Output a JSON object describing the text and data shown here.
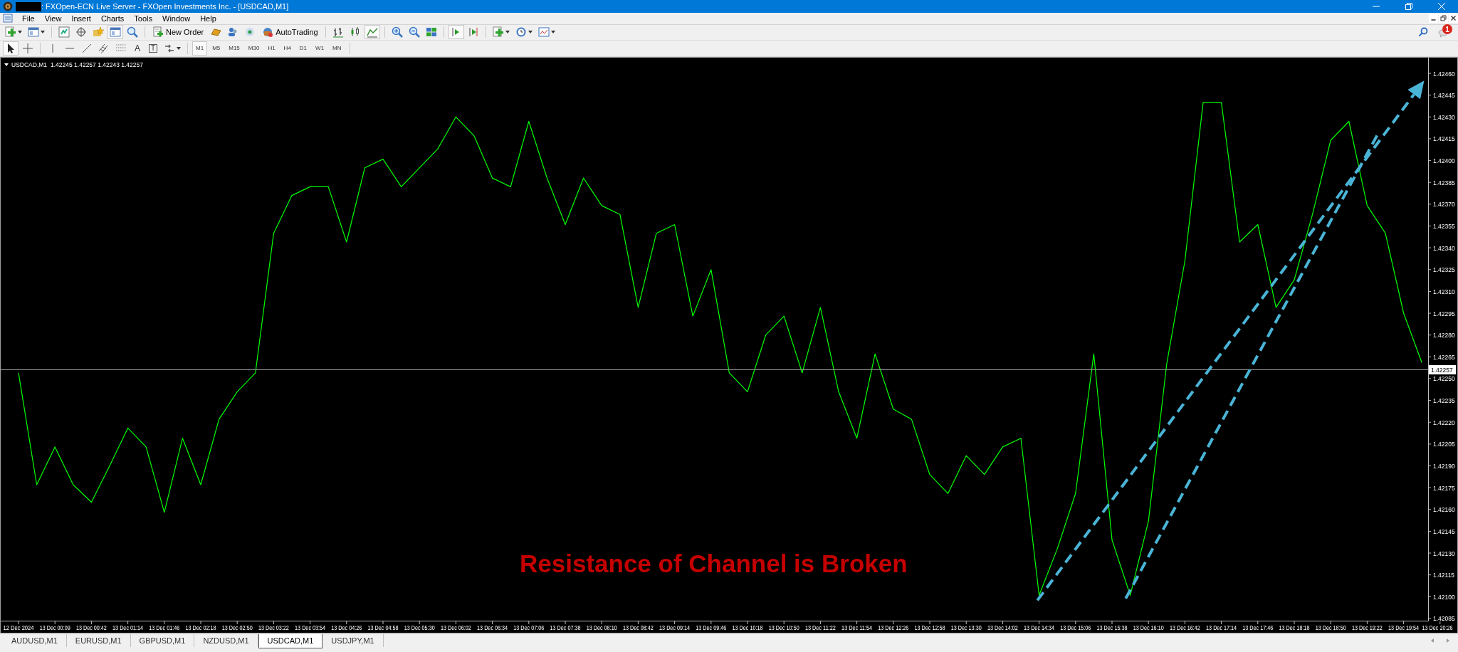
{
  "window": {
    "title": ": FXOpen-ECN Live Server - FXOpen Investments Inc. - [USDCAD,M1]"
  },
  "menu": [
    "File",
    "View",
    "Insert",
    "Charts",
    "Tools",
    "Window",
    "Help"
  ],
  "toolbar": {
    "new_order": "New Order",
    "auto_trading": "AutoTrading",
    "notification_count": "1"
  },
  "drawing_toolbar": {
    "text_tool": "A",
    "label_tool": "T"
  },
  "timeframes": [
    {
      "label": "M1",
      "selected": true
    },
    {
      "label": "M5",
      "selected": false
    },
    {
      "label": "M15",
      "selected": false
    },
    {
      "label": "M30",
      "selected": false
    },
    {
      "label": "H1",
      "selected": false
    },
    {
      "label": "H4",
      "selected": false
    },
    {
      "label": "D1",
      "selected": false
    },
    {
      "label": "W1",
      "selected": false
    },
    {
      "label": "MN",
      "selected": false
    }
  ],
  "chart": {
    "header": "1.42245 1.42257 1.42243 1.42257",
    "annotation": "Resistance of Channel is Broken",
    "chart_data": {
      "type": "line",
      "categories": [
        "12 Dec 2024",
        null,
        "13 Dec 00:09",
        null,
        "13 Dec 00:42",
        null,
        "13 Dec 01:14",
        null,
        "13 Dec 01:46",
        null,
        "13 Dec 02:18",
        null,
        "13 Dec 02:50",
        null,
        "13 Dec 03:22",
        null,
        "13 Dec 03:54",
        null,
        "13 Dec 04:26",
        null,
        "13 Dec 04:58",
        null,
        "13 Dec 05:30",
        null,
        "13 Dec 06:02",
        null,
        "13 Dec 06:34",
        null,
        "13 Dec 07:06",
        null,
        "13 Dec 07:38",
        null,
        "13 Dec 08:10",
        null,
        "13 Dec 08:42",
        null,
        "13 Dec 09:14",
        null,
        "13 Dec 09:46",
        null,
        "13 Dec 10:18",
        null,
        "13 Dec 10:50",
        null,
        "13 Dec 11:22",
        null,
        "13 Dec 11:54",
        null,
        "13 Dec 12:26",
        null,
        "13 Dec 12:58",
        null,
        "13 Dec 13:30",
        null,
        "13 Dec 14:02",
        null,
        "13 Dec 14:34",
        null,
        "13 Dec 15:06",
        null,
        "13 Dec 15:38",
        null,
        "13 Dec 16:10",
        null,
        "13 Dec 16:42",
        null,
        "13 Dec 17:14",
        null,
        "13 Dec 17:46",
        null,
        "13 Dec 18:18",
        null,
        "13 Dec 18:50",
        null,
        "13 Dec 19:22",
        null,
        "13 Dec 19:54",
        null,
        "13 Dec 20:26"
      ],
      "series": [
        {
          "name": "USDCAD,M1",
          "color": "#00ff00",
          "values": [
            1.42254,
            1.42177,
            1.42203,
            1.42177,
            1.42165,
            1.4219,
            1.42216,
            1.42203,
            1.42158,
            1.42209,
            1.42177,
            1.42222,
            1.42241,
            1.42254,
            1.4235,
            1.42376,
            1.42382,
            1.42382,
            1.42344,
            1.42395,
            1.42401,
            1.42382,
            1.42395,
            1.42408,
            1.4243,
            1.42417,
            1.42388,
            1.42382,
            1.42427,
            1.42388,
            1.42356,
            1.42388,
            1.42369,
            1.42363,
            1.42299,
            1.4235,
            1.42356,
            1.42293,
            1.42325,
            1.42254,
            1.42241,
            1.4228,
            1.42293,
            1.42254,
            1.42299,
            1.42241,
            1.42209,
            1.42267,
            1.42229,
            1.42222,
            1.42184,
            1.42171,
            1.42197,
            1.42184,
            1.42203,
            1.42209,
            1.42101,
            1.42133,
            1.42171,
            1.42267,
            1.42139,
            1.42101,
            1.42152,
            1.4226,
            1.42331,
            1.4244,
            1.4244,
            1.42344,
            1.42356,
            1.42299,
            1.42318,
            1.42363,
            1.42414,
            1.42427,
            1.42369,
            1.4235,
            1.42295,
            1.42261,
            null
          ]
        }
      ],
      "ylim": [
        1.420835,
        1.424708
      ],
      "yticks": [
        {
          "value": 1.4246,
          "label": "1.42460"
        },
        {
          "value": 1.42445,
          "label": "1.42445"
        },
        {
          "value": 1.4243,
          "label": "1.42430"
        },
        {
          "value": 1.42415,
          "label": "1.42415"
        },
        {
          "value": 1.424,
          "label": "1.42400"
        },
        {
          "value": 1.42385,
          "label": "1.42385"
        },
        {
          "value": 1.4237,
          "label": "1.42370"
        },
        {
          "value": 1.42355,
          "label": "1.42355"
        },
        {
          "value": 1.4234,
          "label": "1.42340"
        },
        {
          "value": 1.42325,
          "label": "1.42325"
        },
        {
          "value": 1.4231,
          "label": "1.42310"
        },
        {
          "value": 1.42295,
          "label": "1.42295"
        },
        {
          "value": 1.4228,
          "label": "1.42280"
        },
        {
          "value": 1.42265,
          "label": "1.42265"
        },
        {
          "value": 1.4225,
          "label": "1.42250"
        },
        {
          "value": 1.42235,
          "label": "1.42235"
        },
        {
          "value": 1.4222,
          "label": "1.42220"
        },
        {
          "value": 1.42205,
          "label": "1.42205"
        },
        {
          "value": 1.4219,
          "label": "1.42190"
        },
        {
          "value": 1.42175,
          "label": "1.42175"
        },
        {
          "value": 1.4216,
          "label": "1.42160"
        },
        {
          "value": 1.42145,
          "label": "1.42145"
        },
        {
          "value": 1.4213,
          "label": "1.42130"
        },
        {
          "value": 1.42115,
          "label": "1.42115"
        },
        {
          "value": 1.421,
          "label": "1.42100"
        },
        {
          "value": 1.42085,
          "label": "1.42085"
        }
      ]
    },
    "current_price": "1.42257"
  },
  "tabs": [
    {
      "label": "AUDUSD,M1",
      "selected": false
    },
    {
      "label": "EURUSD,M1",
      "selected": false
    },
    {
      "label": "GBPUSD,M1",
      "selected": false
    },
    {
      "label": "NZDUSD,M1",
      "selected": false
    },
    {
      "label": "USDCAD,M1",
      "selected": true
    },
    {
      "label": "USDJPY,M1",
      "selected": false
    }
  ]
}
